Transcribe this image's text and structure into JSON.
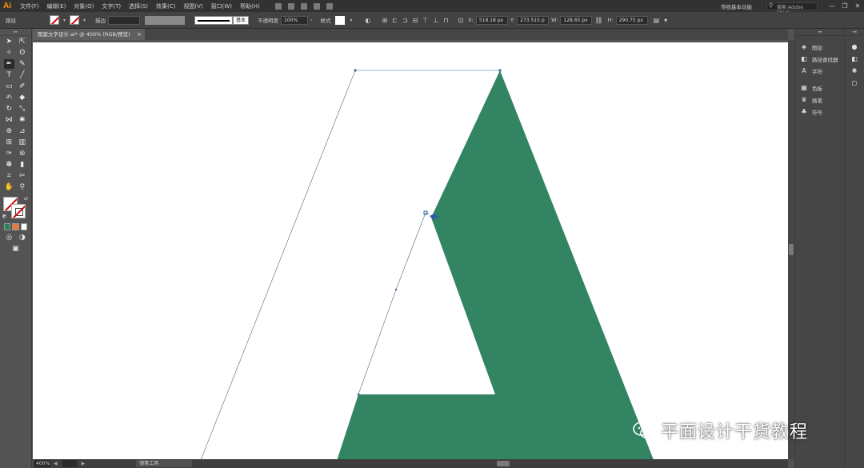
{
  "app": {
    "logo": "Ai",
    "menus": [
      "文件(F)",
      "编辑(E)",
      "对象(O)",
      "文字(T)",
      "选择(S)",
      "效果(C)",
      "视图(V)",
      "窗口(W)",
      "帮助(H)"
    ],
    "workspace": "传统基本功能",
    "search_placeholder": "搜索 Adobe Stock",
    "window_controls": [
      "—",
      "❐",
      "✕"
    ]
  },
  "controlbar": {
    "selection_label": "路径",
    "stroke_label": "描边",
    "stroke_style": "基本",
    "opacity_label": "不透明度",
    "opacity_value": "100%",
    "style_label": "样式",
    "x_value": "518.18 px",
    "y_value": "273.515 p",
    "w_value": "128.65 px",
    "h_value": "290.75 px"
  },
  "document": {
    "tab_title": "图案文字设计.ai* @ 400% (RGB/预览)",
    "tab_close": "×"
  },
  "statusbar": {
    "zoom": "400%",
    "prev": "◀",
    "next": "▶",
    "tool": "钢笔工具"
  },
  "panels": {
    "col1": [
      {
        "icon": "layers-icon",
        "glyph": "◈",
        "label": "图层"
      },
      {
        "icon": "pathfinder-icon",
        "glyph": "◧",
        "label": "路径查找器"
      },
      {
        "icon": "character-icon",
        "glyph": "A",
        "label": "字符"
      },
      {
        "icon": "swatches-icon",
        "glyph": "▦",
        "label": "色板"
      },
      {
        "icon": "brushes-icon",
        "glyph": "♛",
        "label": "画笔"
      },
      {
        "icon": "symbols-icon",
        "glyph": "♣",
        "label": "符号"
      }
    ],
    "col2": [
      {
        "icon": "color-icon",
        "glyph": "●"
      },
      {
        "icon": "color-guide-icon",
        "glyph": "◧"
      },
      {
        "icon": "appearance-icon",
        "glyph": "✺"
      },
      {
        "icon": "transparency-icon",
        "glyph": "◻"
      }
    ]
  },
  "watermark": {
    "text": "平面设计干货教程"
  },
  "colors": {
    "shape_fill": "#338462",
    "path_stroke": "#4a6a8a",
    "anchor": "#2e5aa8"
  }
}
